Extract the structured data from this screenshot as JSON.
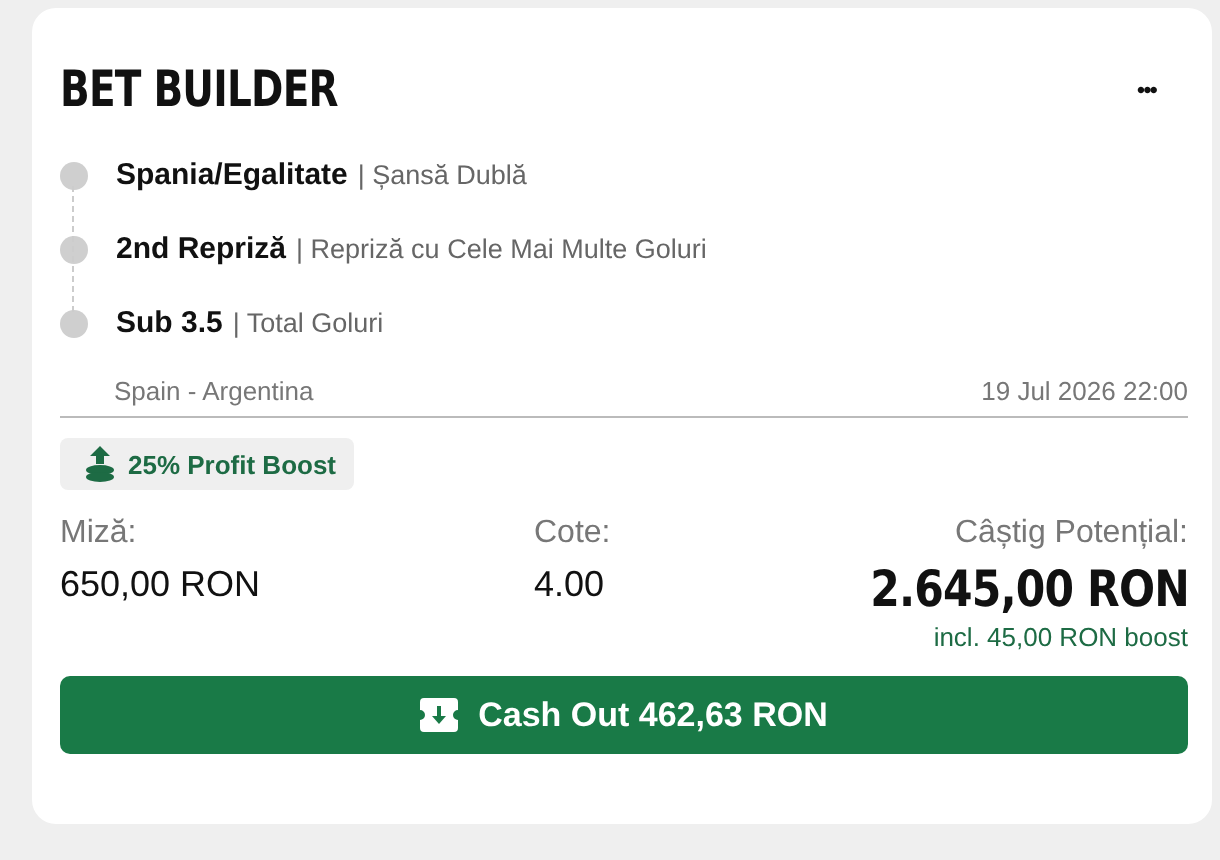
{
  "title": "BET BUILDER",
  "menu": "•••",
  "selections": [
    {
      "pick": "Spania/Egalitate",
      "market": "| Șansă Dublă"
    },
    {
      "pick": "2nd Repriză",
      "market": "| Repriză cu Cele Mai Multe Goluri"
    },
    {
      "pick": "Sub 3.5",
      "market": "| Total Goluri"
    }
  ],
  "event": {
    "name": "Spain - Argentina",
    "date": "19 Jul 2026 22:00"
  },
  "boost_badge": "25% Profit Boost",
  "stake": {
    "label": "Miză:",
    "value": "650,00 RON"
  },
  "odds": {
    "label": "Cote:",
    "value": "4.00"
  },
  "payout": {
    "label": "Câștig Potențial:",
    "value": "2.645,00 RON",
    "note": "incl. 45,00 RON boost"
  },
  "cash_out": "Cash Out 462,63 RON"
}
